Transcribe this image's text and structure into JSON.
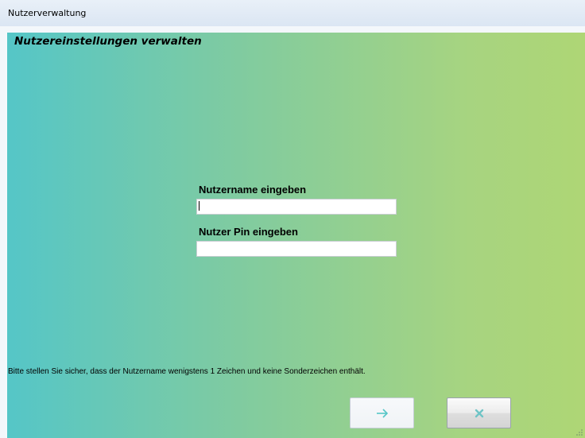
{
  "window": {
    "title": "Nutzerverwaltung"
  },
  "header": {
    "title": "Nutzereinstellungen verwalten"
  },
  "form": {
    "username_label": "Nutzername eingeben",
    "username_value": "",
    "pin_label": "Nutzer Pin eingeben",
    "pin_value": ""
  },
  "hint": "Bitte stellen Sie sicher, dass der Nutzername wenigstens 1 Zeichen und keine Sonderzeichen enthält.",
  "buttons": {
    "ok_icon": "arrow-right-icon",
    "ok_disabled": true,
    "cancel_icon": "close-x-icon"
  },
  "colors": {
    "gradient_start": "#55c6c7",
    "gradient_end": "#aed675",
    "ok_arrow": "#55c6c7",
    "cancel_x": "#6fc4c6"
  }
}
